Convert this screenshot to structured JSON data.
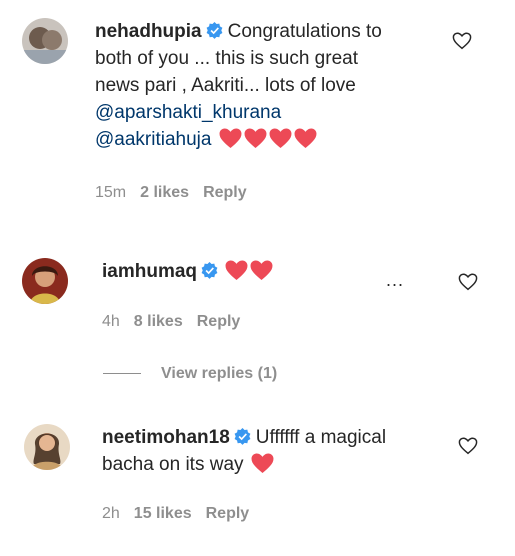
{
  "comments": [
    {
      "username": "nehadhupia",
      "verified": true,
      "text_lines": [
        "Congratulations to",
        "both of you ... this is such great",
        "news pari , Aakriti... lots of love"
      ],
      "mentions": [
        "@aparshakti_khurana",
        "@aakritiahuja"
      ],
      "hearts": 4,
      "time": "15m",
      "likes": "2 likes",
      "reply": "Reply"
    },
    {
      "username": "iamhumaq",
      "verified": true,
      "hearts": 2,
      "more": "...",
      "time": "4h",
      "likes": "8 likes",
      "reply": "Reply",
      "view_replies": "View replies (1)"
    },
    {
      "username": "neetimohan18",
      "verified": true,
      "text_lines": [
        "Uffffff a magical",
        "bacha on its way"
      ],
      "hearts": 1,
      "time": "2h",
      "likes": "15 likes",
      "reply": "Reply"
    }
  ],
  "colors": {
    "text": "#262626",
    "meta": "#8e8e8e",
    "mention": "#00376b",
    "verified": "#3897f0",
    "heart": "#ed4956"
  },
  "icons": [
    "verified-badge-icon",
    "red-heart-emoji",
    "like-heart-outline-icon"
  ]
}
